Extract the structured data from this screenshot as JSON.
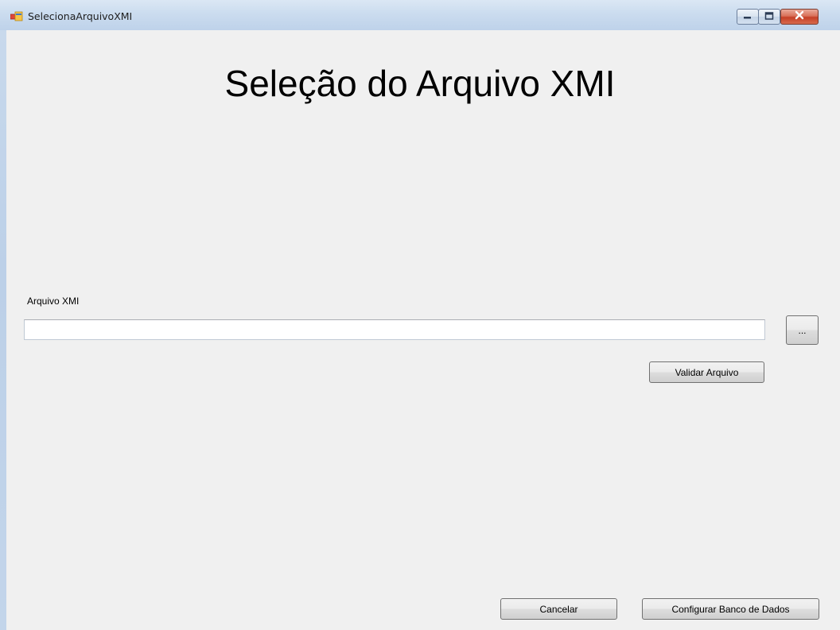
{
  "window": {
    "title": "SelecionaArquivoXMI",
    "icon": "windows-forms-app-icon",
    "controls": {
      "minimize": "minimize-icon",
      "maximize": "maximize-icon",
      "close": "close-icon"
    }
  },
  "main": {
    "heading": "Seleção do Arquivo XMI",
    "file_label": "Arquivo XMI",
    "file_input": {
      "value": "",
      "placeholder": ""
    },
    "browse_label": "...",
    "validate_label": "Validar Arquivo"
  },
  "footer": {
    "cancel_label": "Cancelar",
    "configure_db_label": "Configurar Banco de Dados"
  },
  "colors": {
    "title_bar": "#cbdcef",
    "client_background": "#f0f0f0",
    "close_button": "#c53f26"
  }
}
